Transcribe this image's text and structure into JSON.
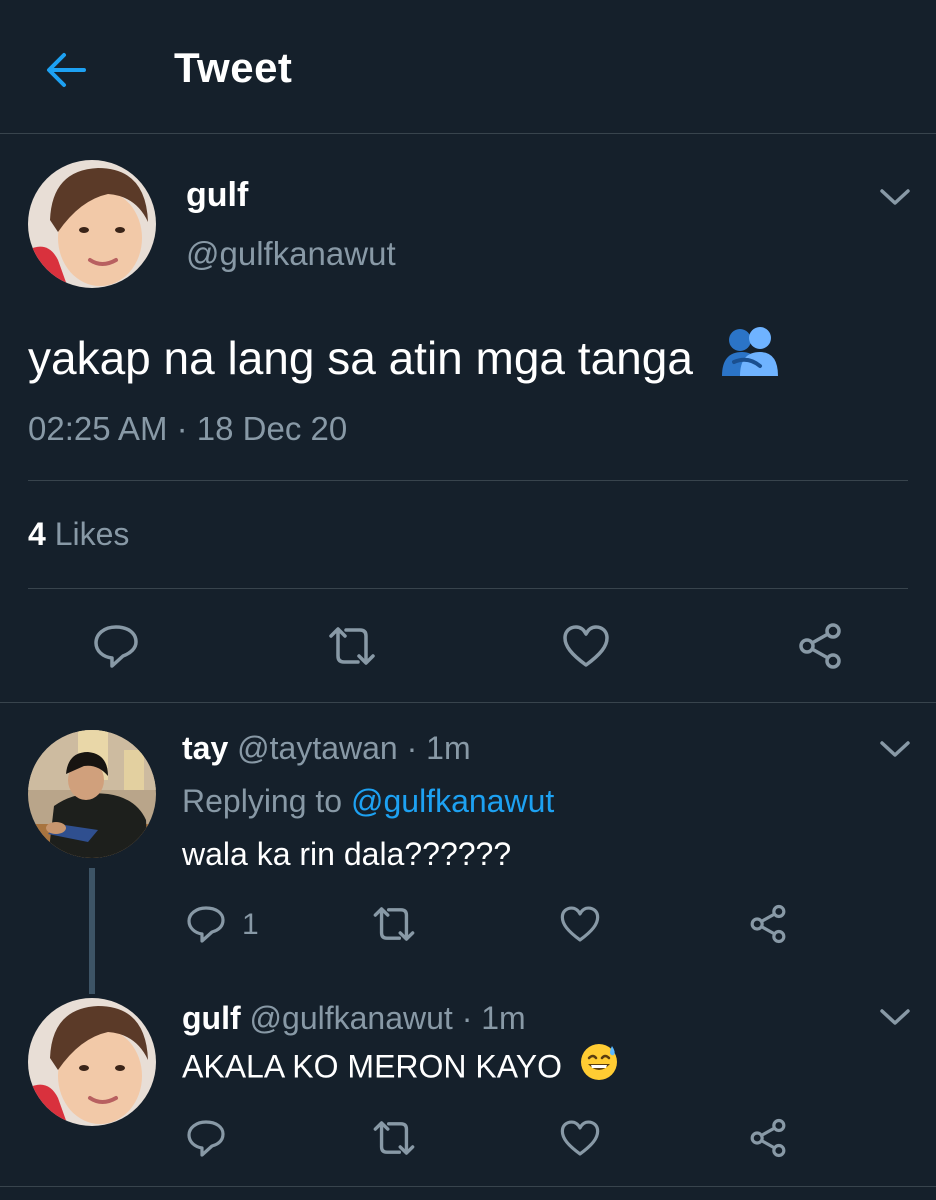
{
  "header": {
    "title": "Tweet"
  },
  "main_tweet": {
    "name": "gulf",
    "handle": "@gulfkanawut",
    "text": "yakap na lang sa atin mga tanga",
    "timestamp": "02:25 AM · 18 Dec 20",
    "likes_count": "4",
    "likes_label": "Likes"
  },
  "replies": [
    {
      "name": "tay",
      "meta": "@taytawan · 1m",
      "replying_to_label": "Replying to",
      "replying_to_handle": "@gulfkanawut",
      "text": "wala ka rin dala??????",
      "reply_count": "1"
    },
    {
      "name": "gulf",
      "meta": "@gulfkanawut · 1m",
      "text": "AKALA KO MERON KAYO"
    }
  ],
  "colors": {
    "background": "#15202b",
    "divider": "#38444d",
    "muted": "#8899a6",
    "accent": "#1da1f2"
  },
  "icons": [
    "back-arrow-icon",
    "chevron-down-icon",
    "reply-icon",
    "retweet-icon",
    "like-icon",
    "share-icon",
    "hug-emoji-icon",
    "sweat-smile-emoji-icon"
  ]
}
